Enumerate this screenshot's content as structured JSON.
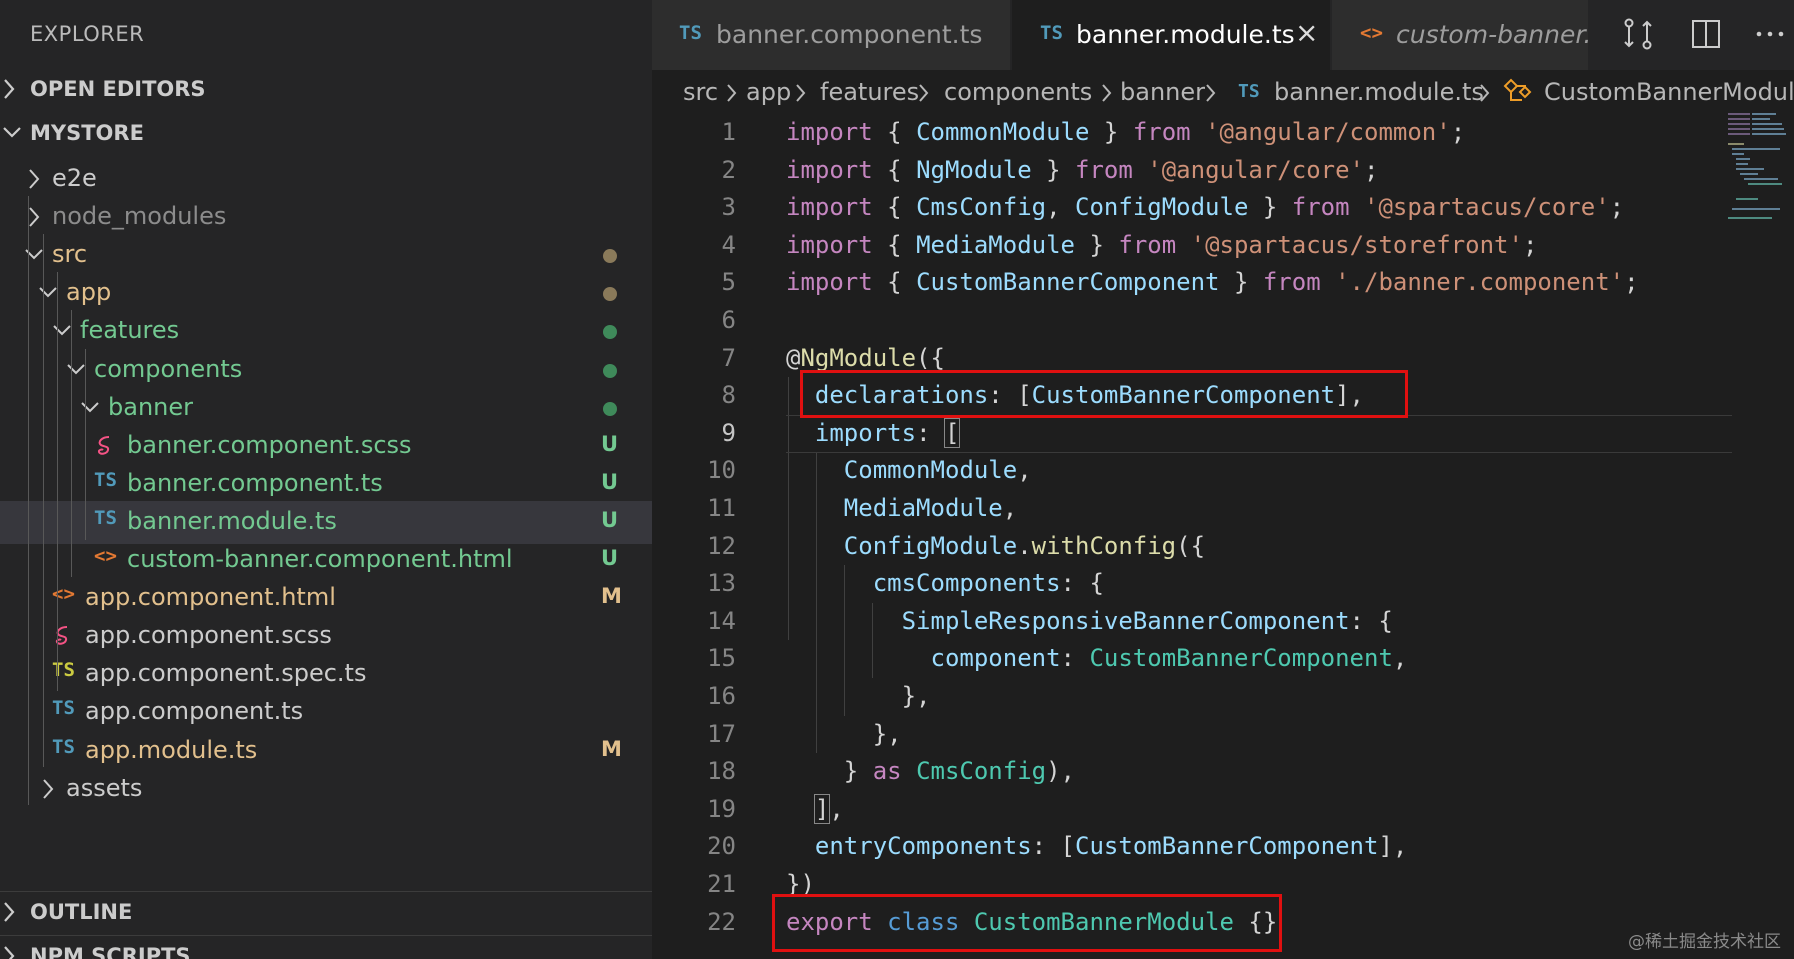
{
  "sidebar": {
    "title": "EXPLORER",
    "open_editors": "OPEN EDITORS",
    "workspace": "MYSTORE",
    "outline": "OUTLINE",
    "npm_scripts": "NPM SCRIPTS",
    "tree": [
      {
        "name": "e2e",
        "kind": "folder",
        "expanded": false,
        "color": "#cccccc"
      },
      {
        "name": "node_modules",
        "kind": "folder",
        "expanded": false,
        "color": "#8c8c8c"
      },
      {
        "name": "src",
        "kind": "folder",
        "expanded": true,
        "color": "#e2c08d",
        "dot": "#8a7a5a"
      },
      {
        "name": "app",
        "kind": "folder",
        "expanded": true,
        "color": "#e2c08d",
        "dot": "#8a7a5a"
      },
      {
        "name": "features",
        "kind": "folder",
        "expanded": true,
        "color": "#73c991",
        "dot": "#3f8a5a"
      },
      {
        "name": "components",
        "kind": "folder",
        "expanded": true,
        "color": "#73c991",
        "dot": "#3f8a5a"
      },
      {
        "name": "banner",
        "kind": "folder",
        "expanded": true,
        "color": "#73c991",
        "dot": "#3f8a5a"
      },
      {
        "name": "banner.component.scss",
        "kind": "scss",
        "color": "#73c991",
        "badge": "U"
      },
      {
        "name": "banner.component.ts",
        "kind": "ts",
        "color": "#73c991",
        "badge": "U"
      },
      {
        "name": "banner.module.ts",
        "kind": "ts",
        "color": "#73c991",
        "badge": "U",
        "selected": true
      },
      {
        "name": "custom-banner.component.html",
        "kind": "html",
        "color": "#73c991",
        "badge": "U"
      },
      {
        "name": "app.component.html",
        "kind": "html",
        "color": "#e2c08d",
        "badge": "M"
      },
      {
        "name": "app.component.scss",
        "kind": "scss",
        "color": "#cccccc"
      },
      {
        "name": "app.component.spec.ts",
        "kind": "tsspec",
        "color": "#cccccc"
      },
      {
        "name": "app.component.ts",
        "kind": "ts",
        "color": "#cccccc"
      },
      {
        "name": "app.module.ts",
        "kind": "ts",
        "color": "#e2c08d",
        "badge": "M"
      },
      {
        "name": "assets",
        "kind": "folder",
        "expanded": false,
        "color": "#cccccc"
      }
    ]
  },
  "icons": {
    "ts": "TS",
    "html": "<>",
    "chevron_right": "chevron-right-icon",
    "chevron_down": "chevron-down-icon",
    "scss": "sass-icon",
    "breadcrumb_symbol": "symbol-class-icon",
    "close": "×"
  },
  "tabs": [
    {
      "label": "banner.component.ts",
      "icon": "TS",
      "active": false
    },
    {
      "label": "banner.module.ts",
      "icon": "TS",
      "active": true
    },
    {
      "label": "custom-banner.component.html",
      "icon": "<>",
      "active": false
    }
  ],
  "breadcrumb": [
    "src",
    "app",
    "features",
    "components",
    "banner",
    "banner.module.ts",
    "CustomBannerModule"
  ],
  "editor": {
    "current_line": 9,
    "lines": [
      [
        [
          "import",
          "kw"
        ],
        [
          " { ",
          "p"
        ],
        [
          "CommonModule",
          "var"
        ],
        [
          " } ",
          "p"
        ],
        [
          "from",
          "kw"
        ],
        [
          " ",
          "p"
        ],
        [
          "'@angular/common'",
          "str"
        ],
        [
          ";",
          "p"
        ]
      ],
      [
        [
          "import",
          "kw"
        ],
        [
          " { ",
          "p"
        ],
        [
          "NgModule",
          "var"
        ],
        [
          " } ",
          "p"
        ],
        [
          "from",
          "kw"
        ],
        [
          " ",
          "p"
        ],
        [
          "'@angular/core'",
          "str"
        ],
        [
          ";",
          "p"
        ]
      ],
      [
        [
          "import",
          "kw"
        ],
        [
          " { ",
          "p"
        ],
        [
          "CmsConfig",
          "var"
        ],
        [
          ", ",
          "p"
        ],
        [
          "ConfigModule",
          "var"
        ],
        [
          " } ",
          "p"
        ],
        [
          "from",
          "kw"
        ],
        [
          " ",
          "p"
        ],
        [
          "'@spartacus/core'",
          "str"
        ],
        [
          ";",
          "p"
        ]
      ],
      [
        [
          "import",
          "kw"
        ],
        [
          " { ",
          "p"
        ],
        [
          "MediaModule",
          "var"
        ],
        [
          " } ",
          "p"
        ],
        [
          "from",
          "kw"
        ],
        [
          " ",
          "p"
        ],
        [
          "'@spartacus/storefront'",
          "str"
        ],
        [
          ";",
          "p"
        ]
      ],
      [
        [
          "import",
          "kw"
        ],
        [
          " { ",
          "p"
        ],
        [
          "CustomBannerComponent",
          "var"
        ],
        [
          " } ",
          "p"
        ],
        [
          "from",
          "kw"
        ],
        [
          " ",
          "p"
        ],
        [
          "'./banner.component'",
          "str"
        ],
        [
          ";",
          "p"
        ]
      ],
      [],
      [
        [
          "@",
          "p"
        ],
        [
          "NgModule",
          "fn"
        ],
        [
          "({",
          "p"
        ]
      ],
      [
        [
          "  ",
          "p"
        ],
        [
          "declarations",
          "var"
        ],
        [
          ": [",
          "p"
        ],
        [
          "CustomBannerComponent",
          "var"
        ],
        [
          "],",
          "p"
        ]
      ],
      [
        [
          "  ",
          "p"
        ],
        [
          "imports",
          "var"
        ],
        [
          ": ",
          "p"
        ],
        [
          "[",
          "p"
        ]
      ],
      [
        [
          "    ",
          "p"
        ],
        [
          "CommonModule",
          "var"
        ],
        [
          ",",
          "p"
        ]
      ],
      [
        [
          "    ",
          "p"
        ],
        [
          "MediaModule",
          "var"
        ],
        [
          ",",
          "p"
        ]
      ],
      [
        [
          "    ",
          "p"
        ],
        [
          "ConfigModule",
          "var"
        ],
        [
          ".",
          "p"
        ],
        [
          "withConfig",
          "fn"
        ],
        [
          "({",
          "p"
        ]
      ],
      [
        [
          "      ",
          "p"
        ],
        [
          "cmsComponents",
          "var"
        ],
        [
          ": {",
          "p"
        ]
      ],
      [
        [
          "        ",
          "p"
        ],
        [
          "SimpleResponsiveBannerComponent",
          "var"
        ],
        [
          ": {",
          "p"
        ]
      ],
      [
        [
          "          ",
          "p"
        ],
        [
          "component",
          "var"
        ],
        [
          ": ",
          "p"
        ],
        [
          "CustomBannerComponent",
          "ty"
        ],
        [
          ",",
          "p"
        ]
      ],
      [
        [
          "        },",
          "p"
        ]
      ],
      [
        [
          "      },",
          "p"
        ]
      ],
      [
        [
          "    } ",
          "p"
        ],
        [
          "as",
          "kw"
        ],
        [
          " ",
          "p"
        ],
        [
          "CmsConfig",
          "ty"
        ],
        [
          "),",
          "p"
        ]
      ],
      [
        [
          "  ",
          "p"
        ],
        [
          "]",
          "p"
        ],
        [
          ",",
          "p"
        ]
      ],
      [
        [
          "  ",
          "p"
        ],
        [
          "entryComponents",
          "var"
        ],
        [
          ": [",
          "p"
        ],
        [
          "CustomBannerComponent",
          "var"
        ],
        [
          "],",
          "p"
        ]
      ],
      [
        [
          "})",
          "p"
        ]
      ],
      [
        [
          "export",
          "kw"
        ],
        [
          " ",
          "p"
        ],
        [
          "class",
          "kw2"
        ],
        [
          " ",
          "p"
        ],
        [
          "CustomBannerModule",
          "ty"
        ],
        [
          " {}",
          "p"
        ]
      ]
    ]
  },
  "colors": {
    "highlight_box": "#e01010",
    "sidebar_bg": "#252526",
    "editor_bg": "#1e1e1e",
    "selected_row": "#37373d"
  },
  "watermark": "@稀土掘金技术社区"
}
